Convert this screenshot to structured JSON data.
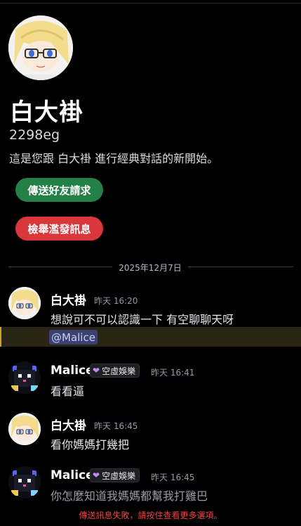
{
  "profile": {
    "display_name": "白大褂",
    "username": "2298eg",
    "intro": "這是您跟 白大褂 進行經典對話的新開始。",
    "avatar": "anime-girl-with-glasses-avatar"
  },
  "actions": {
    "add_friend": "傳送好友請求",
    "report_spam": "檢舉濫發訊息"
  },
  "divider_date": "2025年12月7日",
  "messages": [
    {
      "author": "白大褂",
      "time": "昨天 16:20",
      "lines": [
        "想說可不可以認識一下 有空聊聊天呀"
      ],
      "mention": "@Malice",
      "avatar": "anime-girl-with-glasses-avatar"
    },
    {
      "author": "Malice",
      "role": "空虛娛樂",
      "time": "昨天 16:41",
      "lines": [
        "看看逼"
      ],
      "avatar": "pixel-cat-avatar"
    },
    {
      "author": "白大褂",
      "time": "昨天 16:45",
      "lines": [
        "看你媽媽打幾把"
      ],
      "avatar": "anime-girl-with-glasses-avatar"
    },
    {
      "author": "Malice",
      "role": "空虛娛樂",
      "time": "昨天 16:45",
      "lines": [
        "你怎麼知道我媽媽都幫我打雞巴"
      ],
      "avatar": "pixel-cat-avatar",
      "status": "failed"
    }
  ],
  "error_text": "傳送訊息失敗，請按住查看更多選項。",
  "colors": {
    "background": "#000000",
    "accept_green": "#248046",
    "danger_red": "#da373c",
    "mention_bg": "#3c4270",
    "error_red": "#f23f42",
    "role_heart": "#c58af9"
  }
}
